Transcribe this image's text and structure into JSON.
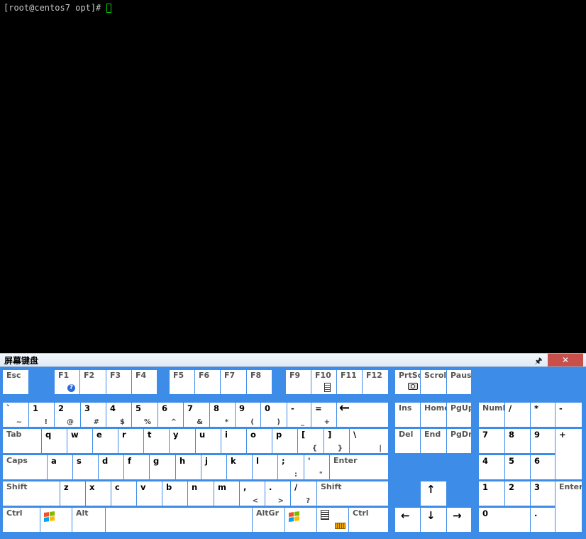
{
  "terminal": {
    "prompt": "[root@centos7 opt]#"
  },
  "osk": {
    "title": "屏幕键盘",
    "pin_icon": "pin-icon",
    "close_icon": "close-icon",
    "keys": {
      "esc": "Esc",
      "f1": "F1",
      "f2": "F2",
      "f3": "F3",
      "f4": "F4",
      "f5": "F5",
      "f6": "F6",
      "f7": "F7",
      "f8": "F8",
      "f9": "F9",
      "f10": "F10",
      "f11": "F11",
      "f12": "F12",
      "prtsc": "PrtSc",
      "scroll": "Scroll",
      "pause": "Pause",
      "backtick": "`",
      "backtick_shift": "~",
      "k1": "1",
      "k1_shift": "!",
      "k2": "2",
      "k2_shift": "@",
      "k3": "3",
      "k3_shift": "#",
      "k4": "4",
      "k4_shift": "$",
      "k5": "5",
      "k5_shift": "%",
      "k6": "6",
      "k6_shift": "^",
      "k7": "7",
      "k7_shift": "&",
      "k8": "8",
      "k8_shift": "*",
      "k9": "9",
      "k9_shift": "(",
      "k0": "0",
      "k0_shift": ")",
      "minus": "-",
      "minus_shift": "_",
      "equals": "=",
      "equals_shift": "+",
      "backspace": "←",
      "ins": "Ins",
      "home": "Home",
      "pgup": "PgUp",
      "numlock": "NumL",
      "num_div": "/",
      "num_mul": "*",
      "num_sub": "-",
      "tab": "Tab",
      "q": "q",
      "w": "w",
      "e": "e",
      "r": "r",
      "t": "t",
      "y": "y",
      "u": "u",
      "i": "i",
      "o": "o",
      "p": "p",
      "lbracket": "[",
      "lbracket_shift": "{",
      "rbracket": "]",
      "rbracket_shift": "}",
      "backslash": "\\",
      "backslash_shift": "|",
      "del": "Del",
      "end": "End",
      "pgdn": "PgDn",
      "num7": "7",
      "num8": "8",
      "num9": "9",
      "num_add": "+",
      "caps": "Caps",
      "a": "a",
      "s": "s",
      "d": "d",
      "f": "f",
      "g": "g",
      "h": "h",
      "j": "j",
      "k": "k",
      "l": "l",
      "semicolon": ";",
      "semicolon_shift": ":",
      "quote": "'",
      "quote_shift": "\"",
      "enter": "Enter",
      "num4": "4",
      "num5": "5",
      "num6": "6",
      "lshift": "Shift",
      "z": "z",
      "x": "x",
      "c": "c",
      "v": "v",
      "b": "b",
      "n": "n",
      "m": "m",
      "comma": ",",
      "comma_shift": "<",
      "period": ".",
      "period_shift": ">",
      "slash": "/",
      "slash_shift": "?",
      "rshift": "Shift",
      "up": "↑",
      "num1": "1",
      "num2": "2",
      "num3": "3",
      "num_enter": "Enter",
      "lctrl": "Ctrl",
      "alt": "Alt",
      "altgr": "AltGr",
      "rctrl": "Ctrl",
      "left": "←",
      "down": "↓",
      "right": "→",
      "num0": "0",
      "num_dot": "."
    },
    "icons": {
      "f1": "help-icon",
      "f10": "calculator-icon",
      "prtsc": "camera-icon",
      "win_left": "windows-logo-icon",
      "win_right": "windows-logo-icon",
      "menu": "context-menu-icon",
      "keyboard": "keyboard-icon"
    }
  }
}
